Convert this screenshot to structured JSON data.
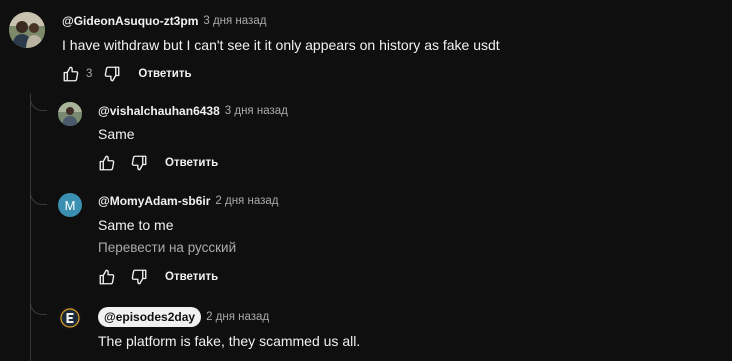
{
  "comments": [
    {
      "author": "@GideonAsuquo-zt3pm",
      "time": "3 дня назад",
      "text": "I have withdraw but I can't see it it only appears on history as fake usdt",
      "likes": "3",
      "reply_label": "Ответить"
    },
    {
      "author": "@vishalchauhan6438",
      "time": "3 дня назад",
      "text": "Same",
      "reply_label": "Ответить"
    },
    {
      "author": "@MomyAdam-sb6ir",
      "avatar_letter": "M",
      "time": "2 дня назад",
      "text": "Same to me",
      "translate_label": "Перевести на русский",
      "reply_label": "Ответить"
    },
    {
      "author": "@episodes2day",
      "time": "2 дня назад",
      "text": "The platform is fake, they scammed us all."
    }
  ],
  "colors": {
    "background": "#0f0f0f",
    "text": "#f1f1f1",
    "secondary": "#aaaaaa",
    "avatar_m": "#3b8fb0"
  }
}
